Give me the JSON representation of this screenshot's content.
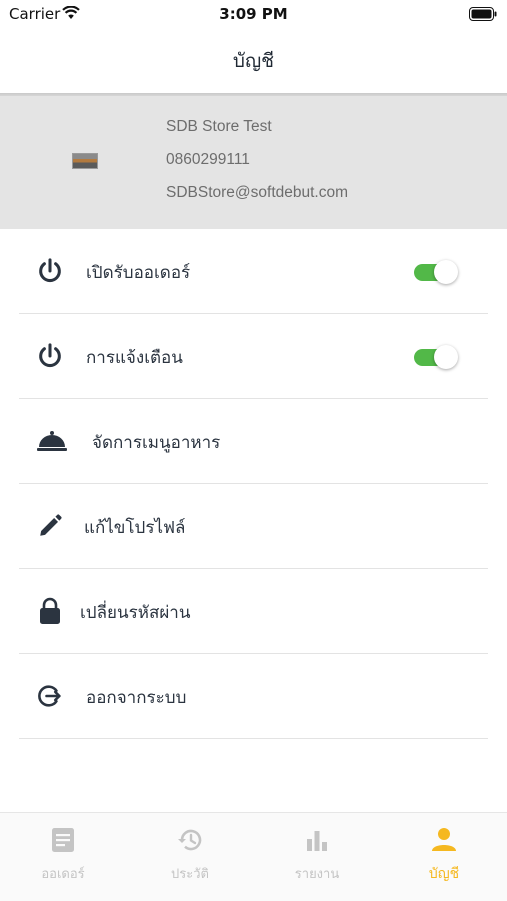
{
  "status_bar": {
    "carrier": "Carrier",
    "time": "3:09 PM"
  },
  "header": {
    "title": "บัญชี"
  },
  "profile": {
    "store_name": "SDB Store Test",
    "phone": "0860299111",
    "email": "SDBStore@softdebut.com"
  },
  "menu": [
    {
      "label": "เปิดรับออเดอร์",
      "icon": "power-icon",
      "toggle": true
    },
    {
      "label": "การแจ้งเตือน",
      "icon": "power-icon",
      "toggle": true
    },
    {
      "label": "จัดการเมนูอาหาร",
      "icon": "food-cloche-icon"
    },
    {
      "label": "แก้ไขโปรไฟล์",
      "icon": "pencil-icon"
    },
    {
      "label": "เปลี่ยนรหัสผ่าน",
      "icon": "lock-icon"
    },
    {
      "label": "ออกจากระบบ",
      "icon": "logout-icon"
    }
  ],
  "tabs": [
    {
      "label": "ออเดอร์",
      "icon": "order-list-icon"
    },
    {
      "label": "ประวัติ",
      "icon": "history-icon"
    },
    {
      "label": "รายงาน",
      "icon": "bar-chart-icon"
    },
    {
      "label": "บัญชี",
      "icon": "person-icon",
      "active": true
    }
  ],
  "colors": {
    "toggle_on": "#52b848",
    "active_tab": "#f5b820",
    "icon": "#2b3440",
    "profile_bg": "#e4e4e4"
  }
}
